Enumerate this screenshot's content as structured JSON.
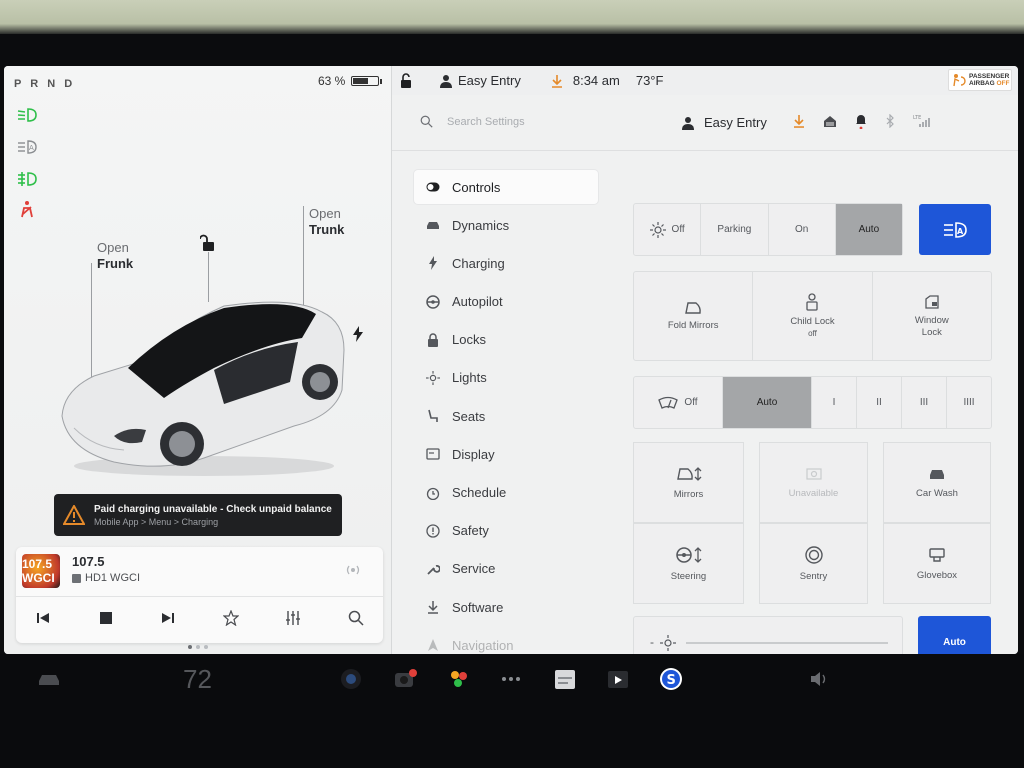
{
  "car_panel": {
    "gear": "P R N D",
    "battery_percent": "63 %",
    "battery_level": 0.63,
    "frunk": {
      "top": "Open",
      "bottom": "Frunk"
    },
    "trunk": {
      "top": "Open",
      "bottom": "Trunk"
    },
    "toast": {
      "title": "Paid charging unavailable - Check unpaid balance",
      "subtitle": "Mobile App > Menu > Charging"
    },
    "media": {
      "logo": "107.5 WGCI",
      "frequency": "107.5",
      "station": "HD1 WGCI"
    }
  },
  "status_bar": {
    "profile": "Easy Entry",
    "time": "8:34 am",
    "temperature": "73°F",
    "airbag": {
      "line1": "PASSENGER",
      "line2": "AIRBAG",
      "state": "OFF"
    }
  },
  "settings": {
    "search_placeholder": "Search Settings",
    "profile": "Easy Entry",
    "nav": [
      {
        "label": "Controls",
        "icon": "toggle-icon"
      },
      {
        "label": "Dynamics",
        "icon": "car-icon"
      },
      {
        "label": "Charging",
        "icon": "bolt-icon"
      },
      {
        "label": "Autopilot",
        "icon": "steering-wheel-icon"
      },
      {
        "label": "Locks",
        "icon": "lock-icon"
      },
      {
        "label": "Lights",
        "icon": "sun-icon"
      },
      {
        "label": "Seats",
        "icon": "seat-icon"
      },
      {
        "label": "Display",
        "icon": "display-icon"
      },
      {
        "label": "Schedule",
        "icon": "clock-icon"
      },
      {
        "label": "Safety",
        "icon": "alert-circle-icon"
      },
      {
        "label": "Service",
        "icon": "wrench-icon"
      },
      {
        "label": "Software",
        "icon": "download-icon"
      },
      {
        "label": "Navigation",
        "icon": "navigation-icon"
      }
    ],
    "headlights": {
      "off": "Off",
      "parking": "Parking",
      "on": "On",
      "auto": "Auto",
      "selected": "Auto"
    },
    "quick": {
      "fold_mirrors": "Fold Mirrors",
      "child_lock": "Child Lock",
      "child_lock_state": "off",
      "window_lock_1": "Window",
      "window_lock_2": "Lock"
    },
    "wipers": {
      "off": "Off",
      "auto": "Auto",
      "l1": "I",
      "l2": "II",
      "l3": "III",
      "l4": "IIII",
      "selected": "Auto"
    },
    "tiles": {
      "mirrors": "Mirrors",
      "unavailable": "Unavailable",
      "car_wash": "Car Wash",
      "steering": "Steering",
      "sentry": "Sentry",
      "glovebox": "Glovebox"
    },
    "brightness": {
      "minus": "-",
      "auto": "Auto"
    }
  },
  "dock": {
    "temperature": "72"
  },
  "colors": {
    "accent_blue": "#1e56d8",
    "tell_green": "#2fbf4a",
    "tell_red": "#e0403a",
    "orange": "#e58a2a"
  }
}
